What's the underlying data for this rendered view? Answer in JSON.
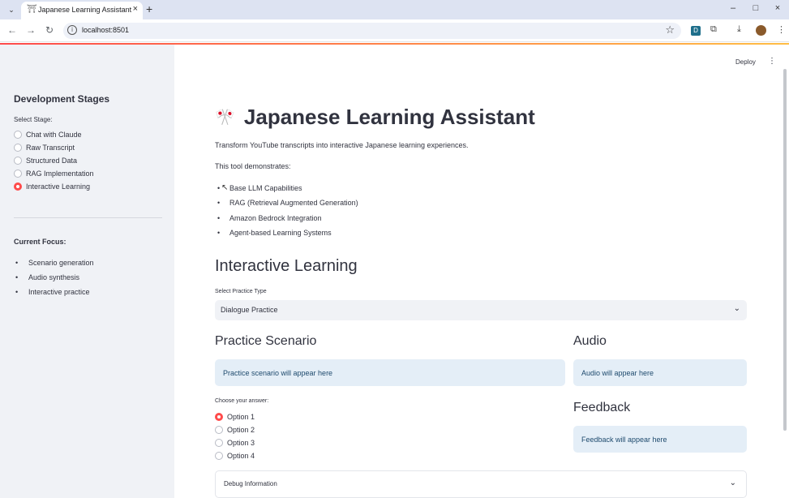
{
  "browser": {
    "tab_title": "Japanese Learning Assistant",
    "url": "localhost:8501",
    "new_tab_label": "+",
    "extension_badge": "D"
  },
  "header": {
    "deploy_label": "Deploy"
  },
  "sidebar": {
    "title": "Development Stages",
    "select_label": "Select Stage:",
    "stages": [
      {
        "label": "Chat with Claude",
        "selected": false
      },
      {
        "label": "Raw Transcript",
        "selected": false
      },
      {
        "label": "Structured Data",
        "selected": false
      },
      {
        "label": "RAG Implementation",
        "selected": false
      },
      {
        "label": "Interactive Learning",
        "selected": true
      }
    ],
    "focus_title": "Current Focus:",
    "focus_items": [
      "Scenario generation",
      "Audio synthesis",
      "Interactive practice"
    ]
  },
  "main": {
    "title": "Japanese Learning Assistant",
    "intro": "Transform YouTube transcripts into interactive Japanese learning experiences.",
    "demonstrates": "This tool demonstrates:",
    "capabilities": [
      "Base LLM Capabilities",
      "RAG (Retrieval Augmented Generation)",
      "Amazon Bedrock Integration",
      "Agent-based Learning Systems"
    ],
    "section_title": "Interactive Learning",
    "practice_type_label": "Select Practice Type",
    "practice_type_value": "Dialogue Practice",
    "scenario_title": "Practice Scenario",
    "scenario_placeholder": "Practice scenario will appear here",
    "answer_label": "Choose your answer:",
    "options": [
      {
        "label": "Option 1",
        "selected": true
      },
      {
        "label": "Option 2",
        "selected": false
      },
      {
        "label": "Option 3",
        "selected": false
      },
      {
        "label": "Option 4",
        "selected": false
      }
    ],
    "audio_title": "Audio",
    "audio_placeholder": "Audio will appear here",
    "feedback_title": "Feedback",
    "feedback_placeholder": "Feedback will appear here",
    "debug_label": "Debug Information"
  },
  "colors": {
    "accent": "#ff4b4b",
    "sidebar_bg": "#f0f2f6",
    "info_bg": "#e4eef7"
  }
}
